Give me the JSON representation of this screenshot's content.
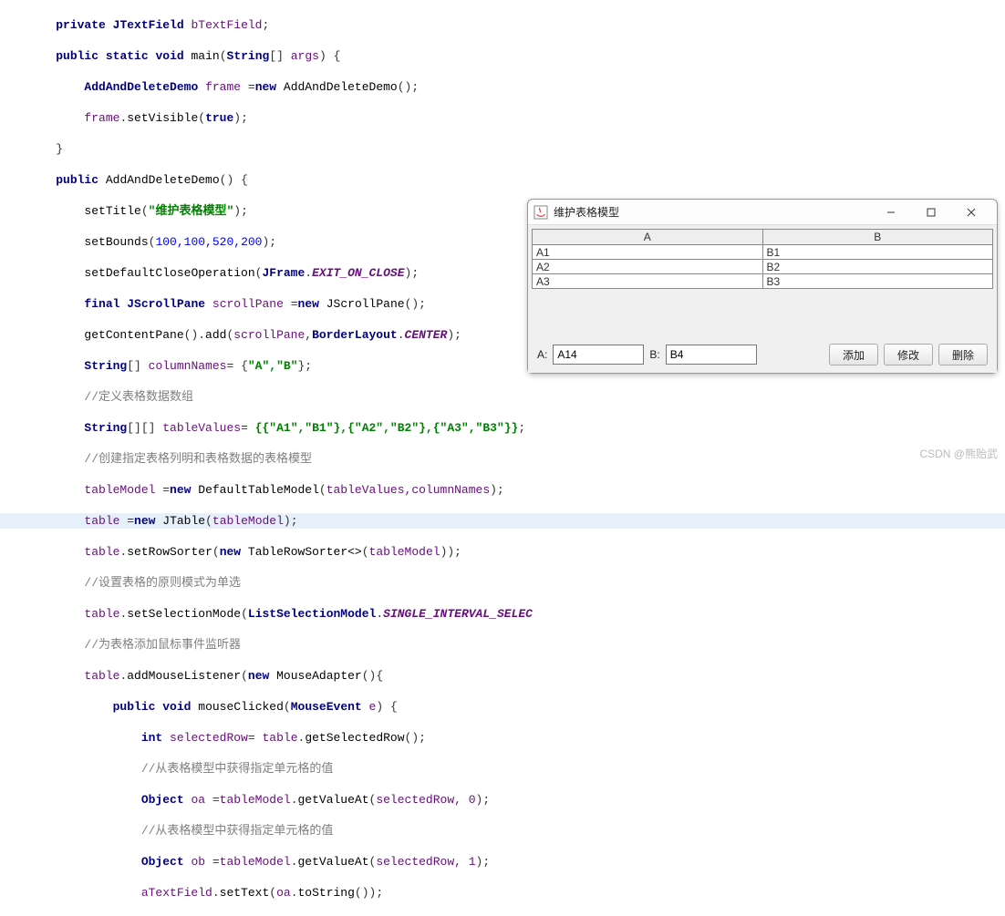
{
  "code": {
    "l1_private": "private",
    "l1_type": "JTextField",
    "l1_ident": "bTextField",
    "l2_public": "public",
    "l2_static": "static",
    "l2_void": "void",
    "l2_main": "main",
    "l2_string": "String",
    "l2_args": "args",
    "l3_type": "AddAndDeleteDemo",
    "l3_ident": "frame",
    "l3_new": "new",
    "l3_ctor": "AddAndDeleteDemo",
    "l4_ident": "frame",
    "l4_fn": "setVisible",
    "l4_true": "true",
    "l6_public": "public",
    "l6_ctor": "AddAndDeleteDemo",
    "l7_fn": "setTitle",
    "l7_str": "\"维护表格模型\"",
    "l8_fn": "setBounds",
    "l8_args": "100,100,520,200",
    "l9_fn": "setDefaultCloseOperation",
    "l9_cls": "JFrame",
    "l9_const": "EXIT_ON_CLOSE",
    "l10_final": "final",
    "l10_type": "JScrollPane",
    "l10_ident": "scrollPane",
    "l10_new": "new",
    "l10_ctor": "JScrollPane",
    "l11_fn1": "getContentPane",
    "l11_fn2": "add",
    "l11_ident": "scrollPane",
    "l11_cls": "BorderLayout",
    "l11_const": "CENTER",
    "l12_type": "String",
    "l12_ident": "columnNames",
    "l12_vals": "\"A\",\"B\"",
    "l13_cmt": "//定义表格数据数组",
    "l14_type": "String",
    "l14_ident": "tableValues",
    "l14_vals": "{{\"A1\",\"B1\"},{\"A2\",\"B2\"},{\"A3\",\"B3\"}}",
    "l15_cmt": "//创建指定表格列明和表格数据的表格模型",
    "l16_ident": "tableModel",
    "l16_new": "new",
    "l16_ctor": "DefaultTableModel",
    "l16_args": "tableValues,columnNames",
    "l17_ident": "table",
    "l17_new": "new",
    "l17_ctor": "JTable",
    "l17_arg": "tableModel",
    "l18_ident": "table",
    "l18_fn": "setRowSorter",
    "l18_new": "new",
    "l18_ctor": "TableRowSorter<>",
    "l18_arg": "tableModel",
    "l19_cmt": "//设置表格的原则模式为单选",
    "l20_ident": "table",
    "l20_fn": "setSelectionMode",
    "l20_cls": "ListSelectionModel",
    "l20_const": "SINGLE_INTERVAL_SELEC",
    "l21_cmt": "//为表格添加鼠标事件监听器",
    "l22_ident": "table",
    "l22_fn": "addMouseListener",
    "l22_new": "new",
    "l22_ctor": "MouseAdapter",
    "l23_public": "public",
    "l23_void": "void",
    "l23_fn": "mouseClicked",
    "l23_type": "MouseEvent",
    "l23_arg": "e",
    "l24_int": "int",
    "l24_ident": "selectedRow",
    "l24_tbl": "table",
    "l24_fn": "getSelectedRow",
    "l25_cmt": "//从表格模型中获得指定单元格的值",
    "l26_type": "Object",
    "l26_ident": "oa",
    "l26_tm": "tableModel",
    "l26_fn": "getValueAt",
    "l26_args": "selectedRow, 0",
    "l27_cmt": "//从表格模型中获得指定单元格的值",
    "l28_type": "Object",
    "l28_ident": "ob",
    "l28_tm": "tableModel",
    "l28_fn": "getValueAt",
    "l28_args": "selectedRow, 1",
    "l29_ident": "aTextField",
    "l29_fn": "setText",
    "l29_oa": "oa",
    "l29_ts": "toString"
  },
  "window": {
    "title": "维护表格模型",
    "columns": [
      "A",
      "B"
    ],
    "rows": [
      [
        "A1",
        "B1"
      ],
      [
        "A2",
        "B2"
      ],
      [
        "A3",
        "B3"
      ]
    ],
    "labelA": "A:",
    "labelB": "B:",
    "valueA": "A14",
    "valueB": "B4",
    "btnAdd": "添加",
    "btnModify": "修改",
    "btnDelete": "删除"
  },
  "watermark": "CSDN @熊贻武"
}
